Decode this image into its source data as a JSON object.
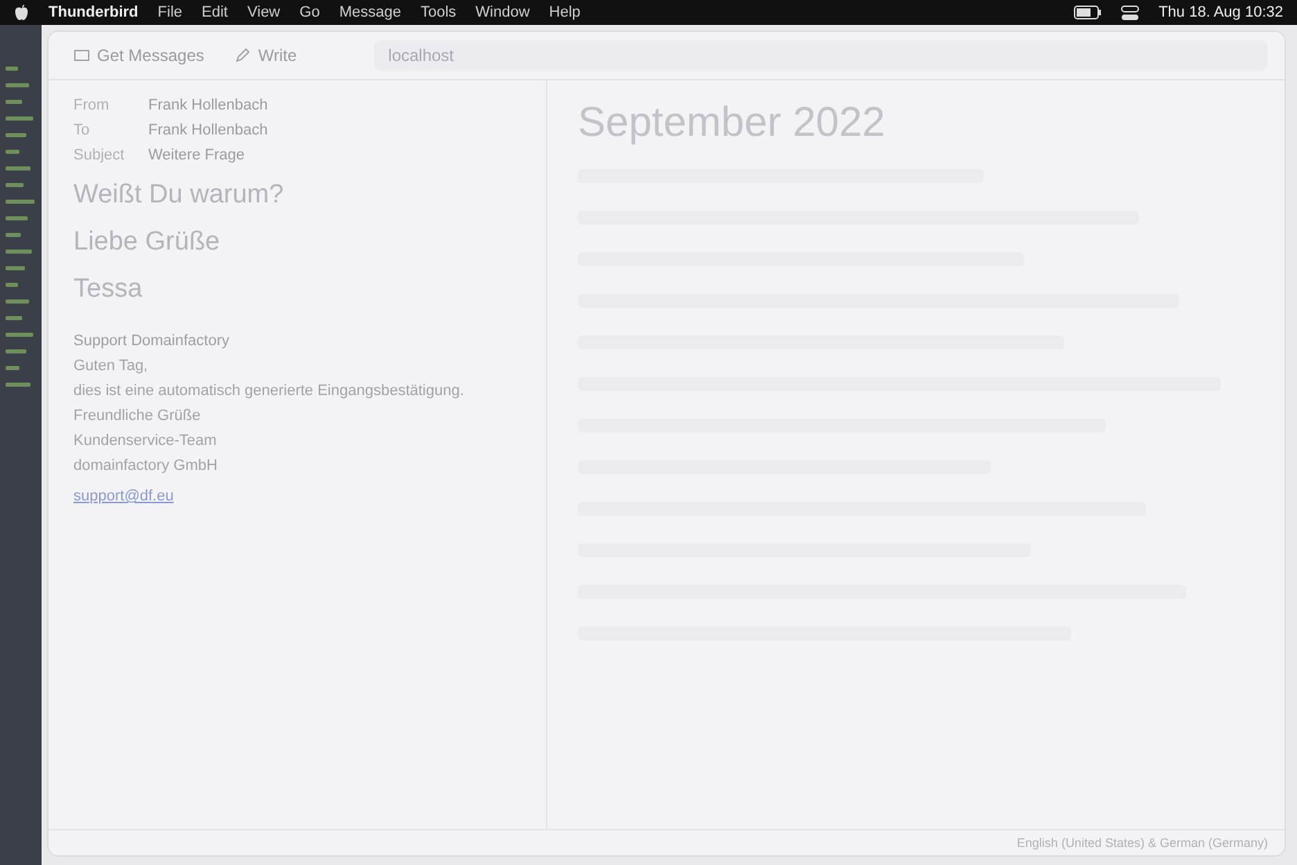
{
  "menu_bar": {
    "app": "Thunderbird",
    "items": [
      "File",
      "Edit",
      "View",
      "Go",
      "Message",
      "Tools",
      "Window",
      "Help"
    ],
    "clock": "Thu 18. Aug 10:32"
  },
  "toolbar": {
    "buttons": [
      "Get Messages",
      "Write"
    ],
    "address": "localhost"
  },
  "email": {
    "from_label": "From",
    "from": "Frank Hollenbach",
    "to_label": "To",
    "to": "Frank Hollenbach",
    "subject_label": "Subject",
    "subject": "Weitere Frage"
  },
  "note": {
    "lines": [
      "Weißt Du warum?",
      "Liebe Grüße",
      "Tessa"
    ]
  },
  "ticket": {
    "sender": "Support Domainfactory",
    "paragraphs": [
      "Guten Tag,",
      "dies ist eine automatisch generierte Eingangsbestätigung.",
      "Freundliche Grüße",
      "Kundenservice-Team",
      "domainfactory GmbH"
    ],
    "link": "support@df.eu"
  },
  "calendar": {
    "heading": "September 2022"
  },
  "status_bar": {
    "language": "English (United States) & German (Germany)"
  }
}
